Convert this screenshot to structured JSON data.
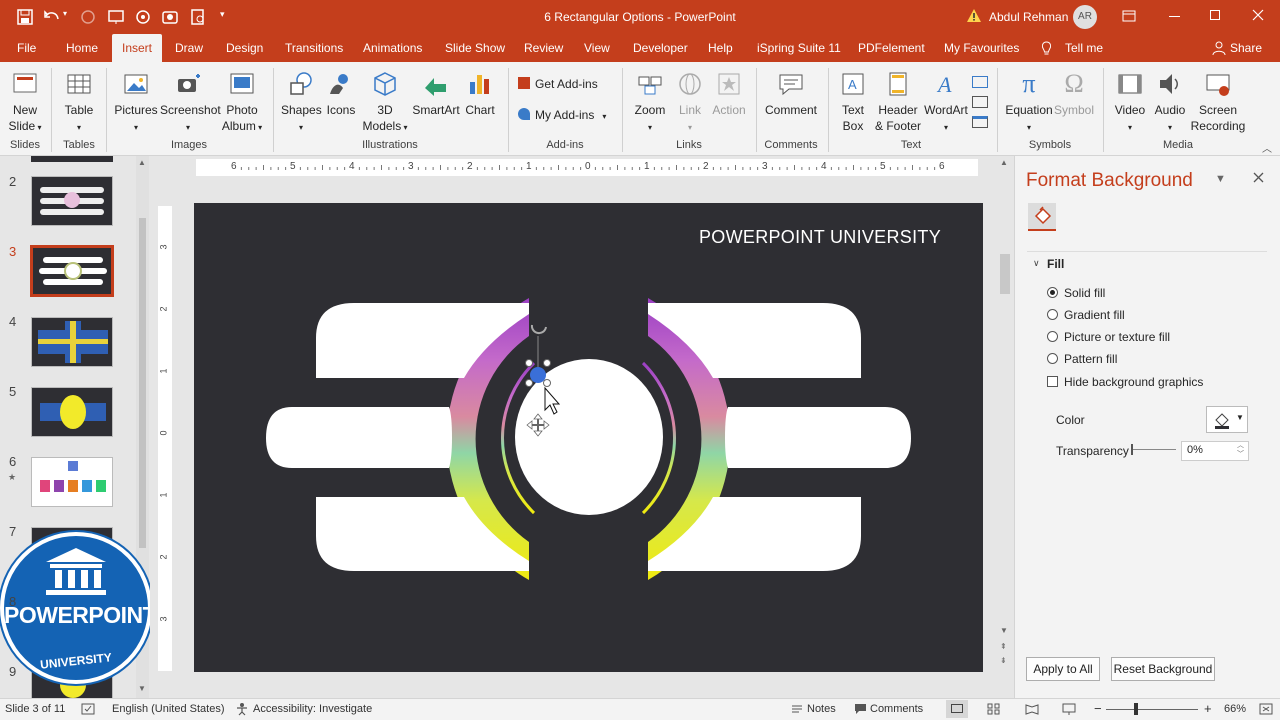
{
  "titlebar": {
    "document_title": "6 Rectangular Options",
    "separator": " - ",
    "app_name": "PowerPoint",
    "user_name": "Abdul Rehman",
    "user_initials": "AR"
  },
  "tabs": [
    "File",
    "Home",
    "Insert",
    "Draw",
    "Design",
    "Transitions",
    "Animations",
    "Slide Show",
    "Review",
    "View",
    "Developer",
    "Help",
    "iSpring Suite 11",
    "PDFelement",
    "My Favourites",
    "Tell me"
  ],
  "share_label": "Share",
  "ribbon": {
    "new_slide": "New",
    "new_slide_2": "Slide",
    "table": "Table",
    "pictures": "Pictures",
    "screenshot": "Screenshot",
    "photo_album": "Photo",
    "photo_album_2": "Album",
    "shapes": "Shapes",
    "icons": "Icons",
    "models_3d": "3D",
    "models_3d_2": "Models",
    "smartart": "SmartArt",
    "chart": "Chart",
    "get_addins": "Get Add-ins",
    "my_addins": "My Add-ins",
    "zoom": "Zoom",
    "link": "Link",
    "action": "Action",
    "comment": "Comment",
    "text_box": "Text",
    "text_box_2": "Box",
    "header_footer": "Header",
    "header_footer_2": "& Footer",
    "wordart": "WordArt",
    "equation": "Equation",
    "symbol": "Symbol",
    "video": "Video",
    "audio": "Audio",
    "screen_recording": "Screen",
    "screen_recording_2": "Recording",
    "groups": {
      "slides": "Slides",
      "tables": "Tables",
      "images": "Images",
      "illustrations": "Illustrations",
      "addins": "Add-ins",
      "links": "Links",
      "comments": "Comments",
      "text": "Text",
      "symbols": "Symbols",
      "media": "Media"
    }
  },
  "thumbnails": {
    "numbers": [
      "2",
      "3",
      "4",
      "5",
      "6",
      "7",
      "8",
      "9"
    ],
    "star": "★"
  },
  "logo": {
    "line1": "POWERPOINT",
    "line2": "UNIVERSITY"
  },
  "slide": {
    "heading": "POWERPOINT UNIVERSITY"
  },
  "ruler": {
    "h_labels": [
      "6",
      "5",
      "4",
      "3",
      "2",
      "1",
      "0",
      "1",
      "2",
      "3",
      "4",
      "5",
      "6"
    ],
    "v_labels": [
      "3",
      "2",
      "1",
      "0",
      "1",
      "2",
      "3"
    ]
  },
  "format_pane": {
    "title": "Format Background",
    "section": "Fill",
    "options": [
      "Solid fill",
      "Gradient fill",
      "Picture or texture fill",
      "Pattern fill"
    ],
    "selected_option": "Solid fill",
    "hide_bg": "Hide background graphics",
    "color_label": "Color",
    "transparency_label": "Transparency",
    "transparency_value": "0%",
    "apply_all": "Apply to All",
    "reset": "Reset Background"
  },
  "status": {
    "slide_info": "Slide 3 of 11",
    "language": "English (United States)",
    "accessibility": "Accessibility: Investigate",
    "notes": "Notes",
    "comments": "Comments",
    "zoom": "66%"
  },
  "colors": {
    "accent": "#c43e1c",
    "slide_bg": "#2e2e33"
  }
}
